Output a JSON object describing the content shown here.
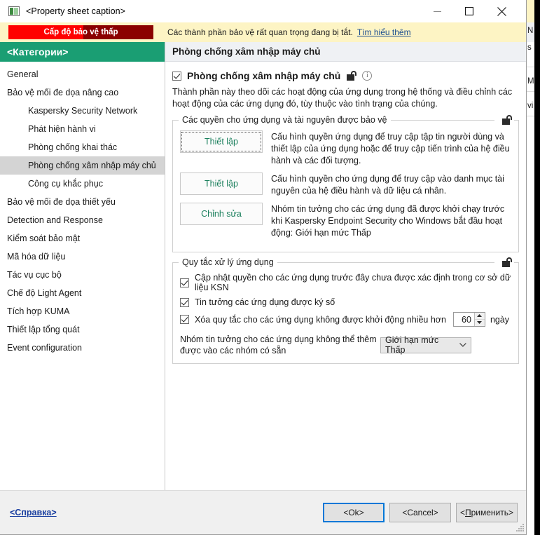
{
  "window": {
    "title": "<Property sheet caption>",
    "app_icon": "window-icon",
    "minimize_icon": "minimize-icon",
    "maximize_icon": "maximize-icon",
    "close_icon": "close-icon"
  },
  "banner": {
    "badge_text": "Cấp độ bảo vệ thấp",
    "message": "Các thành phần bảo vệ rất quan trọng đang bị tắt.",
    "link_text": "Tìm hiểu thêm",
    "badge_fill_color": "#ff0000",
    "badge_bg_color": "#8b0000",
    "background_color": "#fdf4c4"
  },
  "sidebar": {
    "header": "<Категории>",
    "header_color": "#1a9e73",
    "items": [
      {
        "label": "General",
        "indent": false,
        "selected": false
      },
      {
        "label": "Bảo vệ mối đe dọa nâng cao",
        "indent": false,
        "selected": false
      },
      {
        "label": "Kaspersky Security Network",
        "indent": true,
        "selected": false
      },
      {
        "label": "Phát hiện hành vi",
        "indent": true,
        "selected": false
      },
      {
        "label": "Phòng chống khai thác",
        "indent": true,
        "selected": false
      },
      {
        "label": "Phòng chống xâm nhập máy chủ",
        "indent": true,
        "selected": true
      },
      {
        "label": "Công cụ khắc phục",
        "indent": true,
        "selected": false
      },
      {
        "label": "Bảo vệ mối đe dọa thiết yếu",
        "indent": false,
        "selected": false
      },
      {
        "label": "Detection and Response",
        "indent": false,
        "selected": false
      },
      {
        "label": "Kiểm soát bảo mật",
        "indent": false,
        "selected": false
      },
      {
        "label": "Mã hóa dữ liệu",
        "indent": false,
        "selected": false
      },
      {
        "label": "Tác vụ cục bộ",
        "indent": false,
        "selected": false
      },
      {
        "label": "Chế độ Light Agent",
        "indent": false,
        "selected": false
      },
      {
        "label": "Tích hợp KUMA",
        "indent": false,
        "selected": false
      },
      {
        "label": "Thiết lập tổng quát",
        "indent": false,
        "selected": false
      },
      {
        "label": "Event configuration",
        "indent": false,
        "selected": false
      }
    ]
  },
  "content": {
    "header": "Phòng chống xâm nhập máy chủ",
    "enable_checkbox": {
      "label": "Phòng chống xâm nhập máy chủ",
      "checked": true,
      "lock_icon": "unlocked-padlock-icon",
      "info_icon": "info-circle-icon"
    },
    "description": "Thành phần này theo dõi các hoạt động của ứng dụng trong hệ thống và điều chỉnh các hoạt động của các ứng dụng đó, tùy thuộc vào tình trạng của chúng.",
    "group_permissions": {
      "legend": "Các quyền cho ứng dụng và tài nguyên được bảo vệ",
      "lock_icon": "unlocked-padlock-icon",
      "rows": [
        {
          "button": "Thiết lập",
          "text": "Cấu hình quyền ứng dụng để truy cập tập tin người dùng và thiết lập của ứng dụng hoặc để truy cập tiến trình của hệ điều hành và các đối tượng."
        },
        {
          "button": "Thiết lập",
          "text": "Cấu hình quyền cho ứng dụng để truy cập vào danh mục tài nguyên của hệ điều hành và dữ liệu cá nhân."
        },
        {
          "button": "Chỉnh sửa",
          "text": "Nhóm tin tưởng cho các ứng dụng đã được khởi chạy trước khi Kaspersky Endpoint Security cho Windows bắt đầu hoạt động: Giới hạn mức Thấp"
        }
      ]
    },
    "group_rules": {
      "legend": "Quy tắc xử lý ứng dụng",
      "lock_icon": "unlocked-padlock-icon",
      "checkboxes": [
        {
          "label": "Cập nhật quyền cho các ứng dụng trước đây chưa được xác định trong cơ sở dữ liệu KSN",
          "checked": true
        },
        {
          "label": "Tin tưởng các ứng dụng được ký số",
          "checked": true
        },
        {
          "label": "Xóa quy tắc cho các ứng dụng không được khởi động nhiều hơn",
          "checked": true
        }
      ],
      "spinner_value": "60",
      "spinner_unit": "ngày",
      "combo_label": "Nhóm tin tưởng cho các ứng dụng không thể thêm được vào các nhóm có sẵn",
      "combo_value": "Giới hạn mức Thấp",
      "combo_icon": "chevron-down-icon"
    }
  },
  "footer": {
    "help_link": "<Справка>",
    "ok_button": "<Ok>",
    "cancel_button": "<Cancel>",
    "apply_button_prefix": "<",
    "apply_button_accel": "П",
    "apply_button_suffix": "рименить>",
    "default_button_border_color": "#0078d7"
  },
  "background_window": {
    "fragments": [
      "N",
      "s",
      "Ma",
      "vi"
    ]
  }
}
